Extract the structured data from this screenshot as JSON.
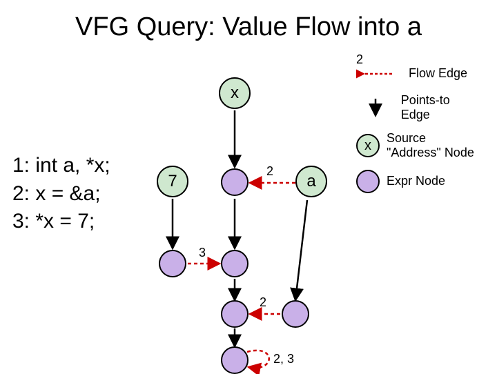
{
  "title": "VFG Query: Value Flow into a",
  "code": {
    "line1": "1: int a, *x;",
    "line2": "2: x = &a;",
    "line3": "3: *x = 7;"
  },
  "nodes": {
    "x": "x",
    "seven": "7",
    "a": "a"
  },
  "edge_labels": {
    "top_right": "2",
    "mid": "2",
    "row3_left": "3",
    "row4": "2",
    "bottom": "2, 3"
  },
  "legend": {
    "flow_edge": "Flow Edge",
    "points_to": "Points-to Edge",
    "source_node_label": "x",
    "source_node_text": "Source \"Address\" Node",
    "expr_node_text": "Expr Node"
  },
  "colors": {
    "source_node": "#CFE8CF",
    "expr_node": "#C9B0E8",
    "flow_edge": "#CC0000",
    "points_to_edge": "#000000"
  }
}
